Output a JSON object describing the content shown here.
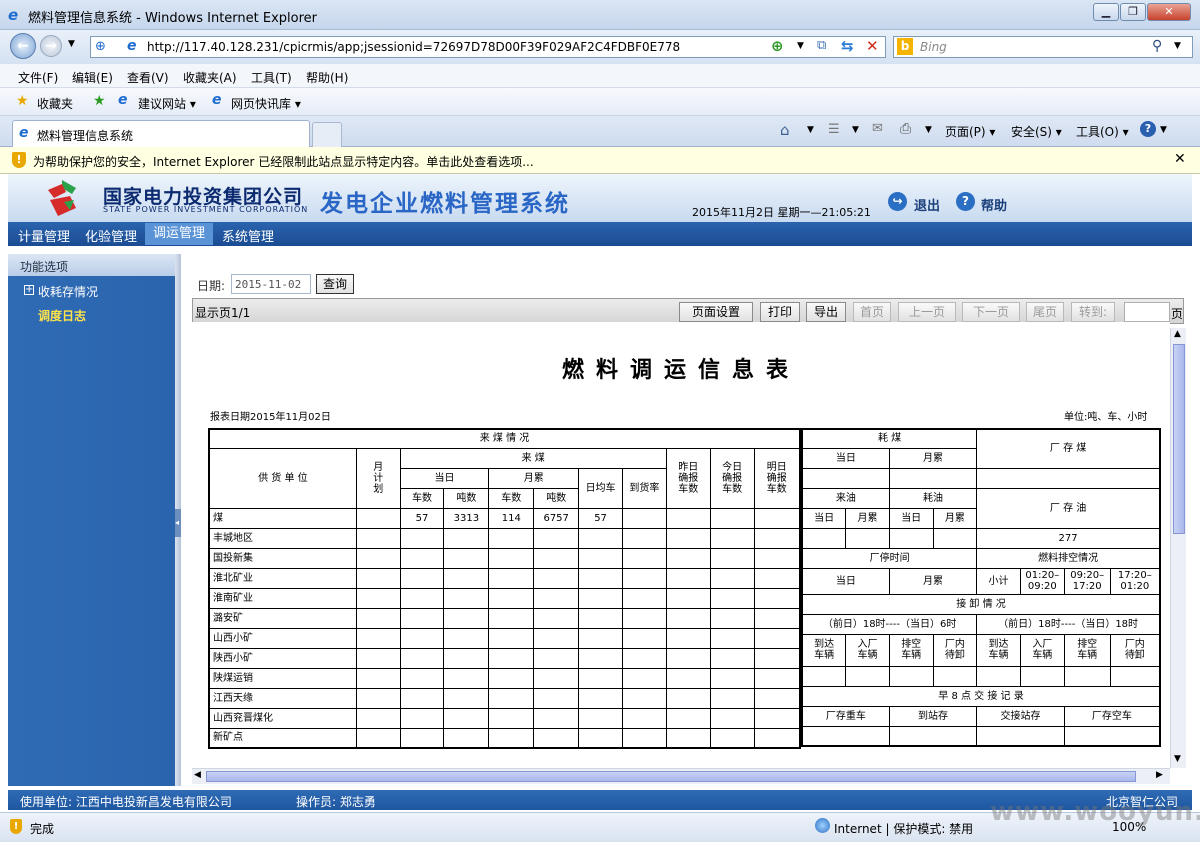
{
  "window": {
    "title": "燃料管理信息系统 - Windows Internet Explorer"
  },
  "browser": {
    "url": "http://117.40.128.231/cpicrmis/app;jsessionid=72697D78D00F39F029AF2C4FDBF0E778",
    "search_placeholder": "Bing",
    "menu": [
      "文件(F)",
      "编辑(E)",
      "查看(V)",
      "收藏夹(A)",
      "工具(T)",
      "帮助(H)"
    ],
    "favorites": {
      "label": "收藏夹",
      "items": [
        "建议网站 ▾",
        "网页快讯库 ▾"
      ]
    },
    "tab_title": "燃料管理信息系统",
    "command_items": [
      "页面(P) ▾",
      "安全(S) ▾",
      "工具(O) ▾"
    ],
    "infobar_text": "为帮助保护您的安全，Internet Explorer 已经限制此站点显示特定内容。单击此处查看选项...",
    "status_done": "完成",
    "zone": "Internet | 保护模式: 禁用",
    "zoom": "100%",
    "watermark": "www.wooyun.org"
  },
  "app": {
    "company_cn": "国家电力投资集团公司",
    "company_en": "STATE POWER INVESTMENT CORPORATION",
    "system_title": "发电企业燃料管理系统",
    "datetime": "2015年11月2日 星期一—21:05:21",
    "logout": "退出",
    "help": "帮助",
    "nav": [
      "计量管理",
      "化验管理",
      "调运管理",
      "系统管理"
    ],
    "sidebar": {
      "header": "功能选项",
      "items": [
        "收耗存情况",
        "调度日志"
      ]
    },
    "query": {
      "date_label": "日期:",
      "date_value": "2015-11-02",
      "button": "查询"
    },
    "viewer": {
      "page_info": "显示页1/1",
      "buttons": [
        "页面设置",
        "打印",
        "导出"
      ],
      "disabled_buttons": [
        "首页",
        "上一页",
        "下一页",
        "尾页",
        "转到:"
      ],
      "page_suffix": "页"
    },
    "footer": {
      "unit": "使用单位:  江西中电投新昌发电有限公司",
      "operator": "操作员:  郑志勇",
      "vendor": "北京智仁公司"
    }
  },
  "report": {
    "title": "燃料调运信息表",
    "report_date": "报表日期2015年11月02日",
    "unit": "单位:吨、车、小时",
    "h": {
      "laimei_qk": "来 煤 情 况",
      "gonghuo": "供 货 单 位",
      "yuejihua": "月\n计\n划",
      "laimei": "来 煤",
      "dangri": "当日",
      "yueleiji": "月累",
      "cheshu": "车数",
      "dunshu": "吨数",
      "rijunche": "日均车",
      "daohuolv": "到货率",
      "zuori": "昨日\n确报\n车数",
      "jinri": "今日\n确报\n车数",
      "mingri": "明日\n确报\n车数",
      "haomei": "耗 煤",
      "changcunmei": "厂 存 煤",
      "laiyou": "来油",
      "haoyou": "耗油",
      "changcunyou": "厂 存 油",
      "tingji": "厂停时间",
      "paikong": "燃料排空情况",
      "xiaoji": "小计",
      "t1": "01:20–\n09:20",
      "t2": "09:20–\n17:20",
      "t3": "17:20–\n01:20",
      "jiexie": "接 卸 情 况",
      "period1": "（前日）18时----（当日）6时",
      "period2": "（前日）18时----（当日）18时",
      "daoda": "到达\n车辆",
      "ruchang": "入厂\n车辆",
      "paikongche": "排空\n车辆",
      "changnei": "厂内\n待卸",
      "jiaojie": "早 8 点 交 接 记 录",
      "zhongche": "厂存重车",
      "daozhan": "到站存",
      "jiaojiezhan": "交接站存",
      "kongche": "厂存空车"
    },
    "coal_row": {
      "name": "煤",
      "d_cars": "57",
      "d_tons": "3313",
      "m_cars": "114",
      "m_tons": "6757",
      "avg": "57"
    },
    "oil_stock": "277",
    "suppliers": [
      "丰城地区",
      "国投新集",
      "淮北矿业",
      "淮南矿业",
      "潞安矿",
      "山西小矿",
      "陕西小矿",
      "陕煤运销",
      "江西天缘",
      "山西兖晋煤化",
      "新矿点"
    ]
  },
  "colors": {
    "accent": "#1a4c92",
    "sidebar": "#2f6bb5",
    "active_item": "#ffe24a"
  }
}
